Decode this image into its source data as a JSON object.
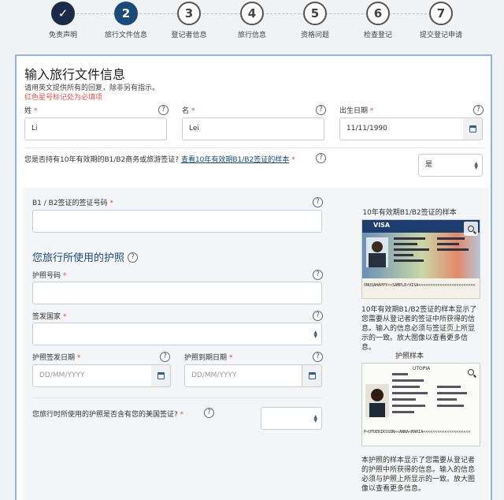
{
  "stepper": {
    "steps": [
      {
        "num": "✓",
        "label": "免责声明",
        "state": "done"
      },
      {
        "num": "2",
        "label": "旅行文件信息",
        "state": "active"
      },
      {
        "num": "3",
        "label": "登记者信息",
        "state": "todo"
      },
      {
        "num": "4",
        "label": "旅行信息",
        "state": "todo"
      },
      {
        "num": "5",
        "label": "资格问题",
        "state": "todo"
      },
      {
        "num": "6",
        "label": "检查登记",
        "state": "todo"
      },
      {
        "num": "7",
        "label": "提交登记申请",
        "state": "todo"
      }
    ]
  },
  "form": {
    "title": "输入旅行文件信息",
    "subtitle": "请用英文提供所有的回复，除非另有指示。",
    "required_note": "红色星号标记处为必填项",
    "surname_label": "姓",
    "surname_value": "Li",
    "given_name_label": "名",
    "given_name_value": "Lei",
    "dob_label": "出生日期",
    "dob_value": "11/11/1990",
    "visa_question": "您是否持有10年有效期的B1/B2商务或旅游签证?",
    "visa_question_link": "查看10年有效期B1/B2签证的样本",
    "visa_question_value": "是",
    "visa_number_label": "B1 / B2签证的签证号码",
    "passport_section_title": "您旅行所使用的护照",
    "passport_number_label": "护照号码",
    "issuing_country_label": "签发国家",
    "issue_date_label": "护照签发日期",
    "issue_date_placeholder": "DD/MM/YYYY",
    "expiry_date_label": "护照到期日期",
    "expiry_date_placeholder": "DD/MM/YYYY",
    "us_visa_question": "您旅行时所使用的护照是否含有您的美国签证?",
    "required_mark": "*",
    "help_mark": "?"
  },
  "samples": {
    "visa_caption": "10年有效期B1/B2签证的样本",
    "visa_text": "10年有效期B1/B2签证的样本显示了您需要从登记者的签证中所获得的信息。输入的信息必须与签证页上所显示的一致。放大图像以查看更多信息。",
    "visa_img_text": "VISA",
    "visa_mrz": "VNUSAHAPPY<<SAMPLE<VISA<<<<<<<<<<<<<<<<<<<<<<<<",
    "passport_caption": "护照样本",
    "passport_text": "本护照的样本显示了您需要从登记者的护照中所获得的信息。输入的信息必须与护照上所显示的一致。放大图像以查看更多信息。",
    "passport_img_text": "UTOPIA",
    "passport_mrz": "P<UTOERIKSSON<<ANNA<MARIA<<<<<<<<<<<<<<<<<<<<"
  },
  "colors": {
    "accent": "#1a4a7a",
    "required": "#d9534f",
    "card_border": "#8fb6e0"
  }
}
